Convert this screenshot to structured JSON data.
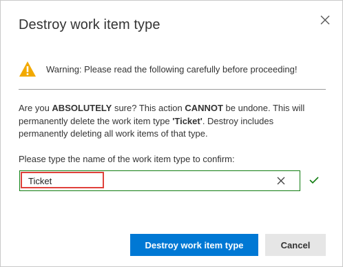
{
  "dialog": {
    "title": "Destroy work item type",
    "close_icon": "close-icon"
  },
  "warning": {
    "icon": "warning-icon",
    "icon_color": "#f2a900",
    "text": "Warning: Please read the following carefully before proceeding!"
  },
  "body": {
    "t1": "Are you ",
    "b1": "ABSOLUTELY",
    "t2": " sure? This action ",
    "b2": "CANNOT",
    "t3": " be undone. This will permanently delete the work item type ",
    "b3": "'Ticket'",
    "t4": ". Destroy includes permanently deleting all work items of that type."
  },
  "confirm": {
    "label": "Please type the name of the work item type to confirm:",
    "value": "Ticket",
    "clear_icon": "close-icon",
    "valid_icon": "checkmark-icon",
    "valid_color": "#107c10"
  },
  "buttons": {
    "destroy_label": "Destroy work item type",
    "cancel_label": "Cancel",
    "primary_color": "#0078d4"
  }
}
